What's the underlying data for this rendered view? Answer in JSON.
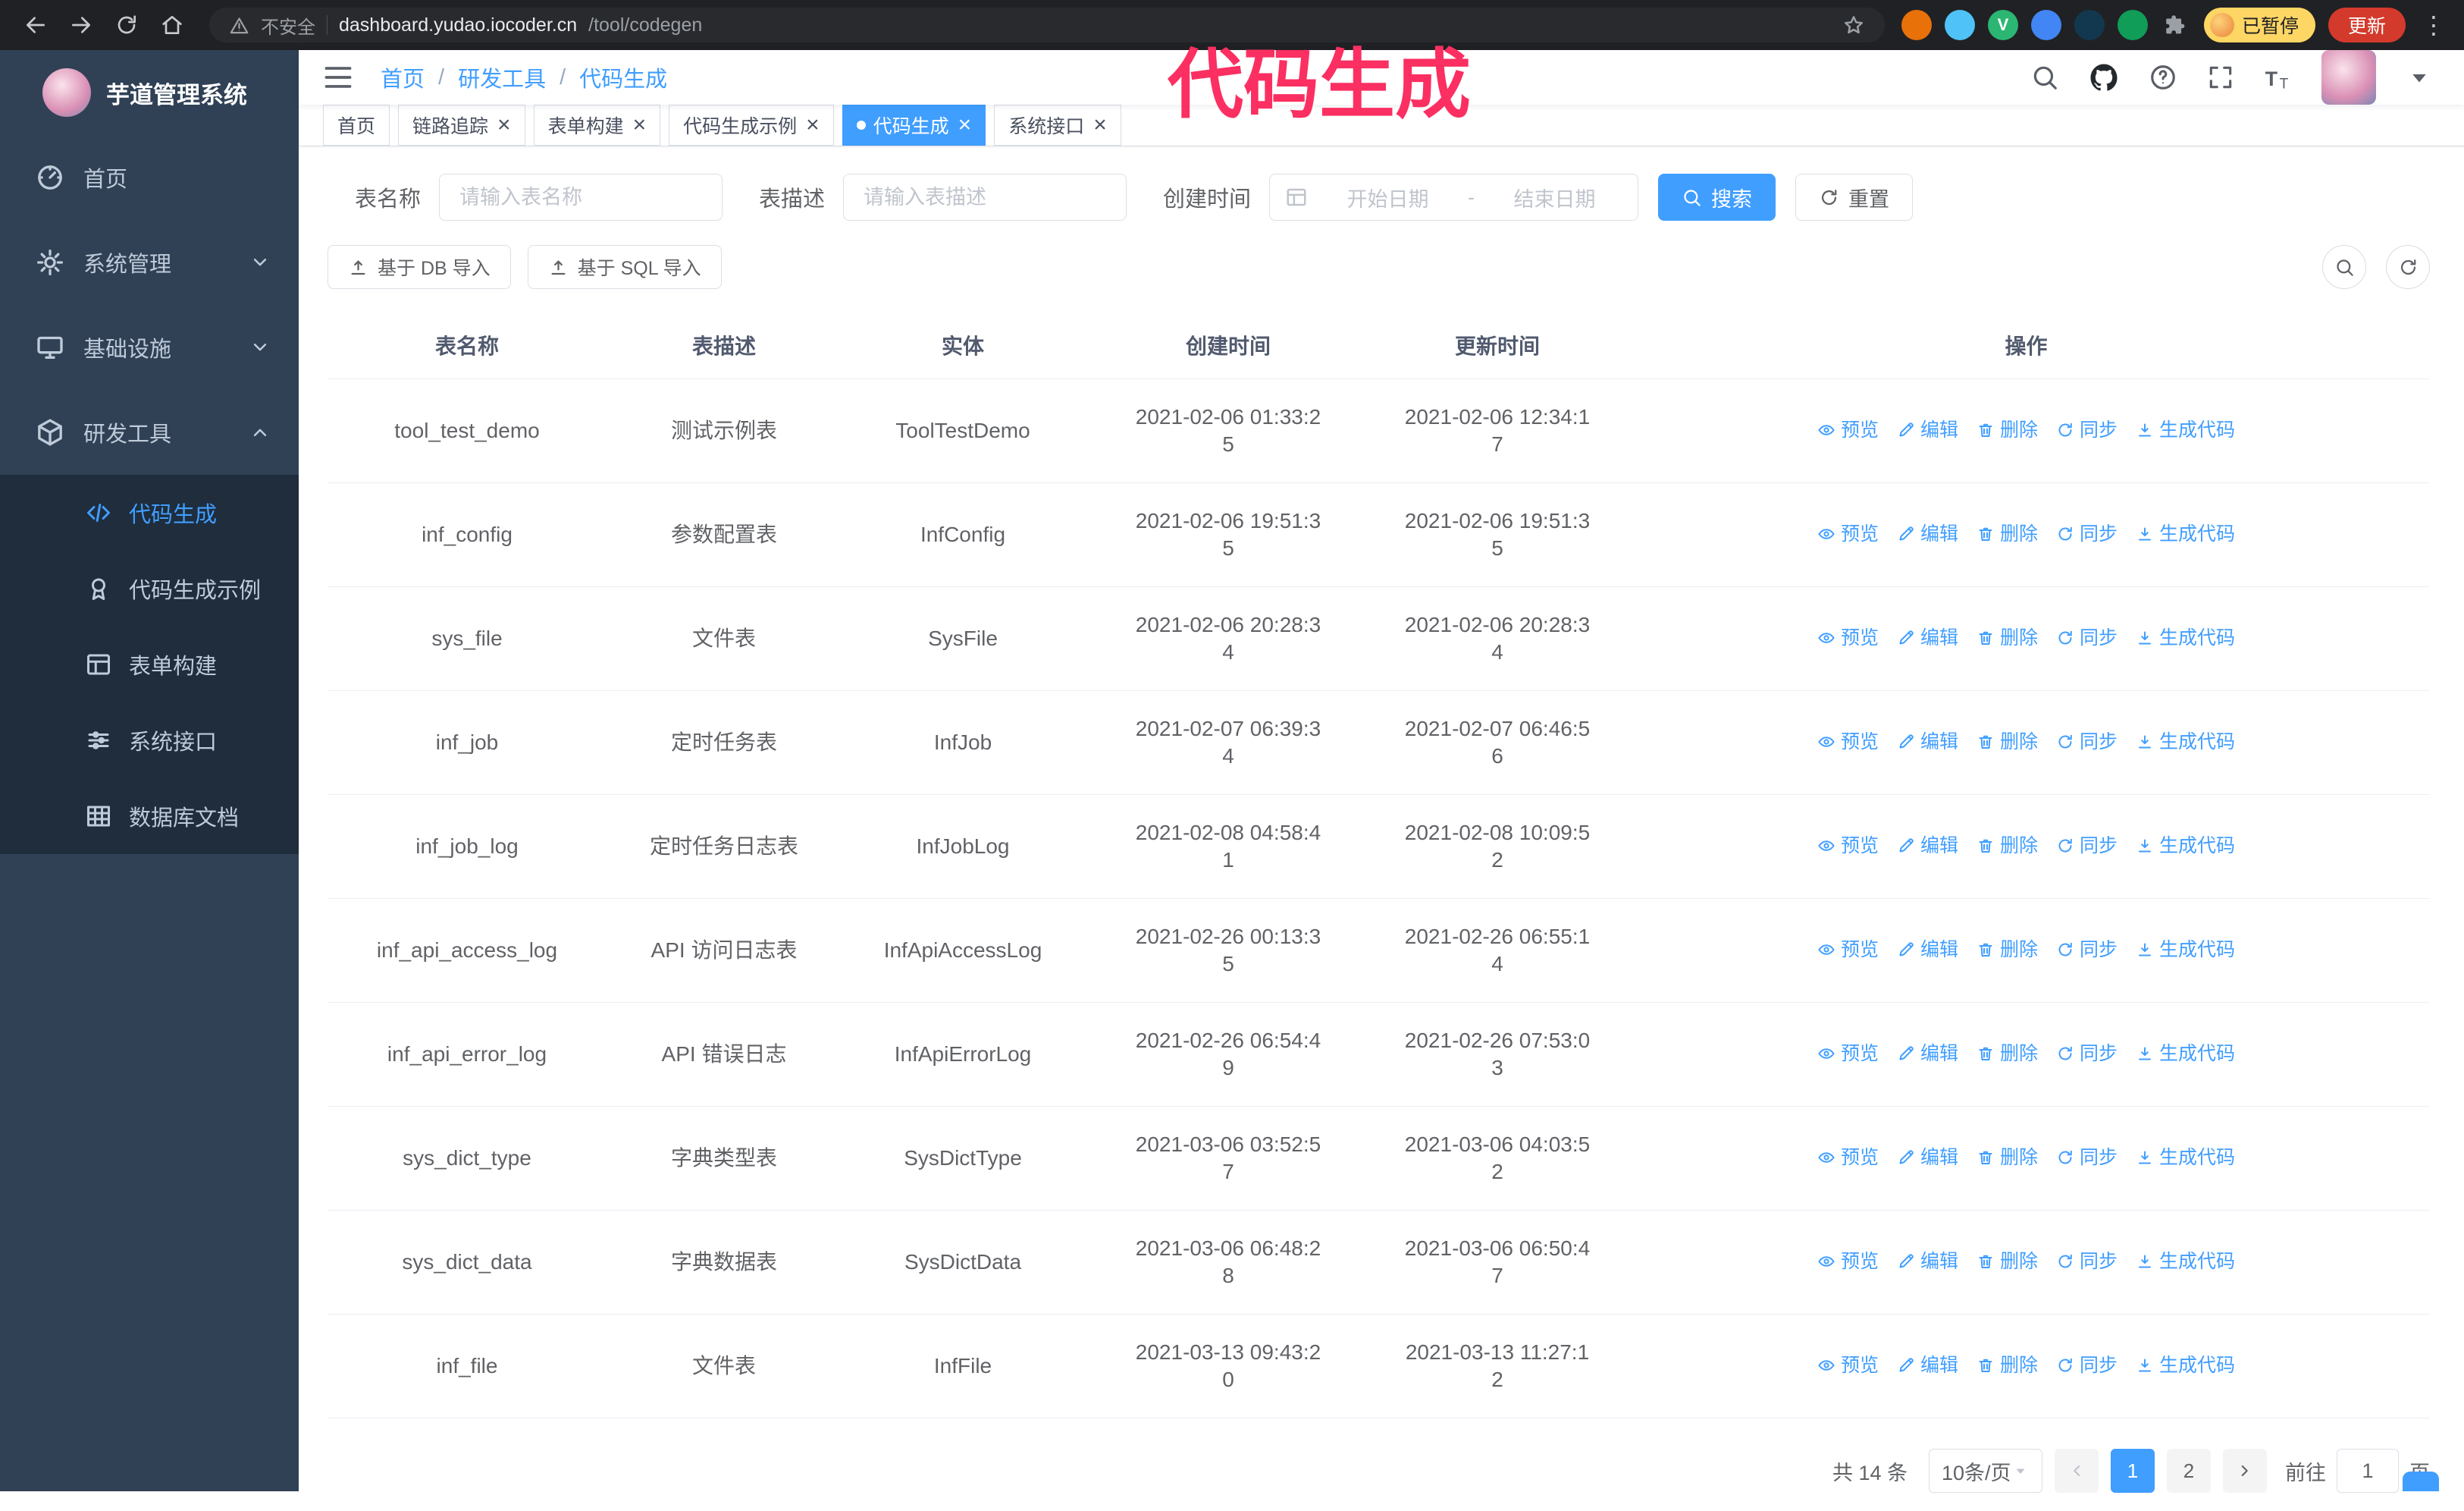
{
  "annotation": {
    "text": "代码生成"
  },
  "colors": {
    "primary": "#409eff",
    "sidebar_bg": "#304156",
    "submenu_bg": "#1f2d3d",
    "annotation_pink": "#fb2f61",
    "update_button_red": "#d33a2c",
    "paused_badge_yellow": "#fdd663",
    "chrome_bg": "#202124"
  },
  "browser": {
    "url_security": "不安全",
    "url_host": "dashboard.yudao.iocoder.cn",
    "url_path": "/tool/codegen",
    "profile_badge": "已暂停",
    "update_button": "更新"
  },
  "sidebar": {
    "logo_title": "芋道管理系统",
    "items": [
      {
        "label": "首页",
        "icon": "dashboard-icon"
      },
      {
        "label": "系统管理",
        "icon": "gear-icon"
      },
      {
        "label": "基础设施",
        "icon": "monitor-icon"
      },
      {
        "label": "研发工具",
        "icon": "toolbox-icon"
      }
    ],
    "submenu": [
      {
        "label": "代码生成",
        "icon": "code-icon",
        "active": true
      },
      {
        "label": "代码生成示例",
        "icon": "badge-icon"
      },
      {
        "label": "表单构建",
        "icon": "form-icon"
      },
      {
        "label": "系统接口",
        "icon": "api-icon"
      },
      {
        "label": "数据库文档",
        "icon": "table-grid-icon"
      }
    ]
  },
  "header": {
    "breadcrumb": [
      "首页",
      "研发工具",
      "代码生成"
    ],
    "separator": "/"
  },
  "tabs": [
    {
      "label": "首页",
      "closable": false,
      "active": false
    },
    {
      "label": "链路追踪",
      "closable": true,
      "active": false
    },
    {
      "label": "表单构建",
      "closable": true,
      "active": false
    },
    {
      "label": "代码生成示例",
      "closable": true,
      "active": false
    },
    {
      "label": "代码生成",
      "closable": true,
      "active": true
    },
    {
      "label": "系统接口",
      "closable": true,
      "active": false
    }
  ],
  "filters": {
    "table_name_label": "表名称",
    "table_name_placeholder": "请输入表名称",
    "table_desc_label": "表描述",
    "table_desc_placeholder": "请输入表描述",
    "create_time_label": "创建时间",
    "date_start_placeholder": "开始日期",
    "date_separator": "-",
    "date_end_placeholder": "结束日期",
    "search_button": "搜索",
    "reset_button": "重置"
  },
  "toolbar": {
    "import_db_button": "基于 DB 导入",
    "import_sql_button": "基于 SQL 导入"
  },
  "table": {
    "columns": [
      "表名称",
      "表描述",
      "实体",
      "创建时间",
      "更新时间",
      "操作"
    ],
    "actions": [
      "预览",
      "编辑",
      "删除",
      "同步",
      "生成代码"
    ],
    "rows": [
      {
        "name": "tool_test_demo",
        "desc": "测试示例表",
        "entity": "ToolTestDemo",
        "created": "2021-02-06 01:33:25",
        "updated": "2021-02-06 12:34:17"
      },
      {
        "name": "inf_config",
        "desc": "参数配置表",
        "entity": "InfConfig",
        "created": "2021-02-06 19:51:35",
        "updated": "2021-02-06 19:51:35"
      },
      {
        "name": "sys_file",
        "desc": "文件表",
        "entity": "SysFile",
        "created": "2021-02-06 20:28:34",
        "updated": "2021-02-06 20:28:34"
      },
      {
        "name": "inf_job",
        "desc": "定时任务表",
        "entity": "InfJob",
        "created": "2021-02-07 06:39:34",
        "updated": "2021-02-07 06:46:56"
      },
      {
        "name": "inf_job_log",
        "desc": "定时任务日志表",
        "entity": "InfJobLog",
        "created": "2021-02-08 04:58:41",
        "updated": "2021-02-08 10:09:52"
      },
      {
        "name": "inf_api_access_log",
        "desc": "API 访问日志表",
        "entity": "InfApiAccessLog",
        "created": "2021-02-26 00:13:35",
        "updated": "2021-02-26 06:55:14"
      },
      {
        "name": "inf_api_error_log",
        "desc": "API 错误日志",
        "entity": "InfApiErrorLog",
        "created": "2021-02-26 06:54:49",
        "updated": "2021-02-26 07:53:03"
      },
      {
        "name": "sys_dict_type",
        "desc": "字典类型表",
        "entity": "SysDictType",
        "created": "2021-03-06 03:52:57",
        "updated": "2021-03-06 04:03:52"
      },
      {
        "name": "sys_dict_data",
        "desc": "字典数据表",
        "entity": "SysDictData",
        "created": "2021-03-06 06:48:28",
        "updated": "2021-03-06 06:50:47"
      },
      {
        "name": "inf_file",
        "desc": "文件表",
        "entity": "InfFile",
        "created": "2021-03-13 09:43:20",
        "updated": "2021-03-13 11:27:12"
      }
    ]
  },
  "pagination": {
    "total": "共 14 条",
    "page_size": "10条/页",
    "pages": [
      "1",
      "2"
    ],
    "active_page": "1",
    "goto_label": "前往",
    "goto_value": "1",
    "goto_suffix": "页"
  }
}
